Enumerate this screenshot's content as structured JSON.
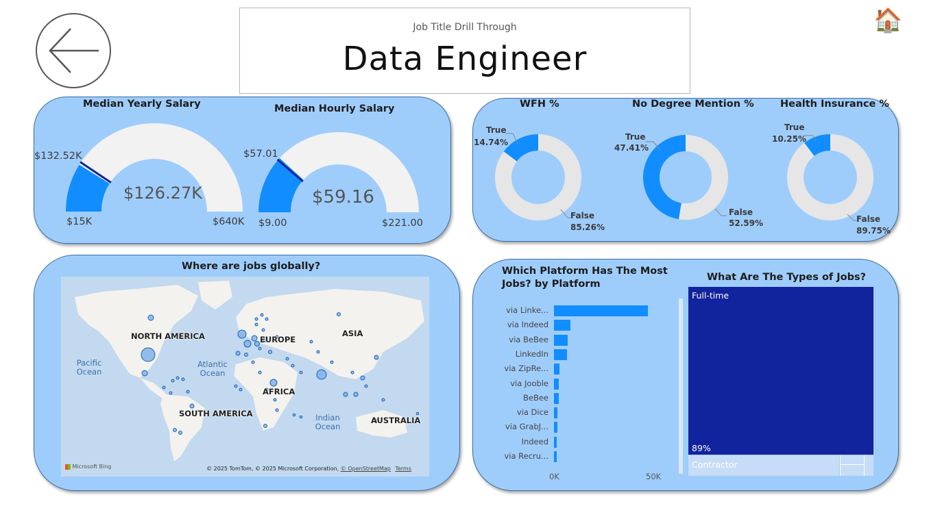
{
  "header": {
    "subtitle": "Job Title Drill Through",
    "title": "Data Engineer"
  },
  "nav": {
    "back_icon": "back-arrow-icon",
    "home_icon": "home-icon",
    "home_glyph": "🏠"
  },
  "colors": {
    "card_bg": "#9fcdfb",
    "accent": "#118dff",
    "dark_blue": "#12239e",
    "track": "#f2f2f2",
    "donut_false": "#e6e6e6"
  },
  "salary": {
    "yearly": {
      "title": "Median Yearly Salary",
      "value": "$126.27K",
      "min": "$15K",
      "max": "$640K",
      "target": "$132.52K",
      "min_num": 15000,
      "max_num": 640000,
      "value_num": 126270,
      "target_num": 132520
    },
    "hourly": {
      "title": "Median Hourly Salary",
      "value": "$59.16",
      "min": "$9.00",
      "max": "$221.00",
      "target": "$57.01",
      "min_num": 9,
      "max_num": 221,
      "value_num": 59.16,
      "target_num": 57.01
    }
  },
  "donuts": [
    {
      "title": "WFH %",
      "true_label": "True",
      "true_pct": "14.74%",
      "false_label": "False",
      "false_pct": "85.26%",
      "true_value": 14.74
    },
    {
      "title": "No Degree Mention %",
      "true_label": "True",
      "true_pct": "47.41%",
      "false_label": "False",
      "false_pct": "52.59%",
      "true_value": 47.41
    },
    {
      "title": "Health Insurance %",
      "true_label": "True",
      "true_pct": "10.25%",
      "false_label": "False",
      "false_pct": "89.75%",
      "true_value": 10.25
    }
  ],
  "map": {
    "title": "Where are jobs globally?",
    "continents": [
      "NORTH AMERICA",
      "EUROPE",
      "ASIA",
      "AFRICA",
      "SOUTH AMERICA",
      "AUSTRALIA"
    ],
    "oceans": [
      "Pacific Ocean",
      "Atlantic Ocean",
      "Indian Ocean"
    ],
    "logo": "Microsoft Bing",
    "attribution": "© 2025 TomTom, © 2025 Microsoft Corporation,",
    "attribution_link": "© OpenStreetMap",
    "terms": "Terms"
  },
  "chart_data": [
    {
      "type": "bar",
      "title": "Which Platform Has The Most Jobs? by Platform",
      "categories": [
        "via Linke...",
        "via Indeed",
        "via BeBee",
        "LinkedIn",
        "via ZipRe...",
        "via Jooble",
        "BeBee",
        "via Dice",
        "via GrabJ...",
        "Indeed",
        "via Recru..."
      ],
      "values": [
        48500,
        8500,
        7200,
        6800,
        2900,
        2600,
        2400,
        1700,
        1600,
        1500,
        1400
      ],
      "xticks": [
        "0K",
        "50K"
      ],
      "xlim": [
        0,
        50000
      ]
    },
    {
      "type": "treemap",
      "title": "What Are The Types of Jobs?",
      "categories": [
        "Full-time",
        "Contractor"
      ],
      "labels": [
        "89%"
      ],
      "values": [
        89,
        9
      ]
    }
  ]
}
